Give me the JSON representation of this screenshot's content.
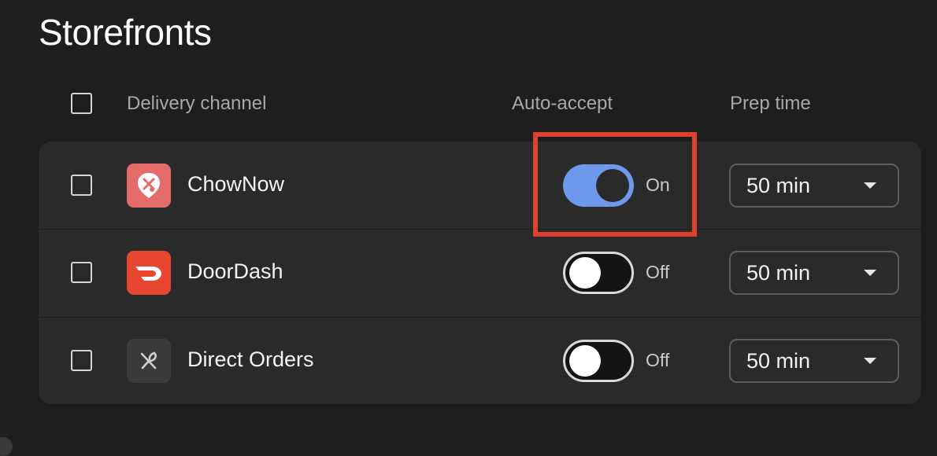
{
  "page": {
    "title": "Storefronts"
  },
  "table": {
    "headers": {
      "channel": "Delivery channel",
      "auto_accept": "Auto-accept",
      "prep_time": "Prep time"
    },
    "rows": [
      {
        "name": "ChowNow",
        "icon": "chownow-logo-icon",
        "icon_color": "#e56a6a",
        "auto_accept": true,
        "auto_accept_label": "On",
        "prep_time": "50 min"
      },
      {
        "name": "DoorDash",
        "icon": "doordash-logo-icon",
        "icon_color": "#e8462e",
        "auto_accept": false,
        "auto_accept_label": "Off",
        "prep_time": "50 min"
      },
      {
        "name": "Direct Orders",
        "icon": "utensils-icon",
        "icon_color": "#3a3a3b",
        "auto_accept": false,
        "auto_accept_label": "Off",
        "prep_time": "50 min"
      }
    ]
  },
  "colors": {
    "background": "#1e1e1f",
    "panel": "#2a2a2b",
    "toggle_on": "#6d98ec",
    "highlight": "#e2402e"
  }
}
